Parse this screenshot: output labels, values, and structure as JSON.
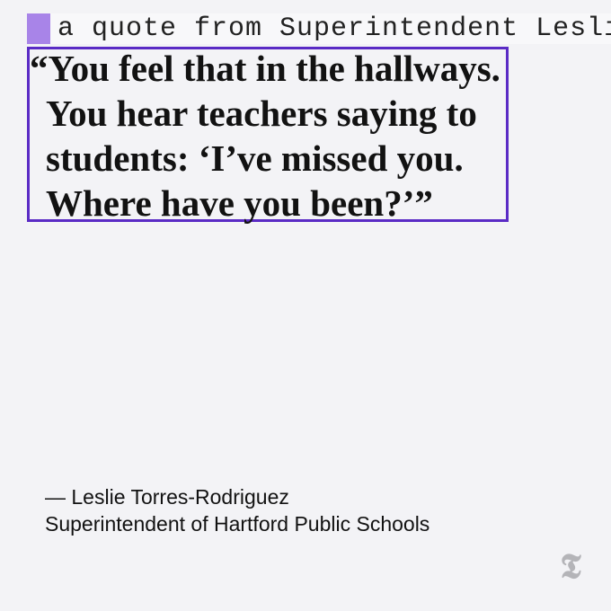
{
  "caption": {
    "text": "a quote from Superintendent Leslie"
  },
  "quote": {
    "lines": [
      "“You feel that in the hallways.",
      "You hear teachers saying to",
      "students: ‘I’ve missed you.",
      "Where have you been?’”"
    ]
  },
  "attribution": {
    "name": "— Leslie Torres-Rodriguez",
    "title": "Superintendent of Hartford Public Schools"
  },
  "logo": {
    "glyph": "𝕿",
    "icon": "nyt-t-logo-icon"
  }
}
